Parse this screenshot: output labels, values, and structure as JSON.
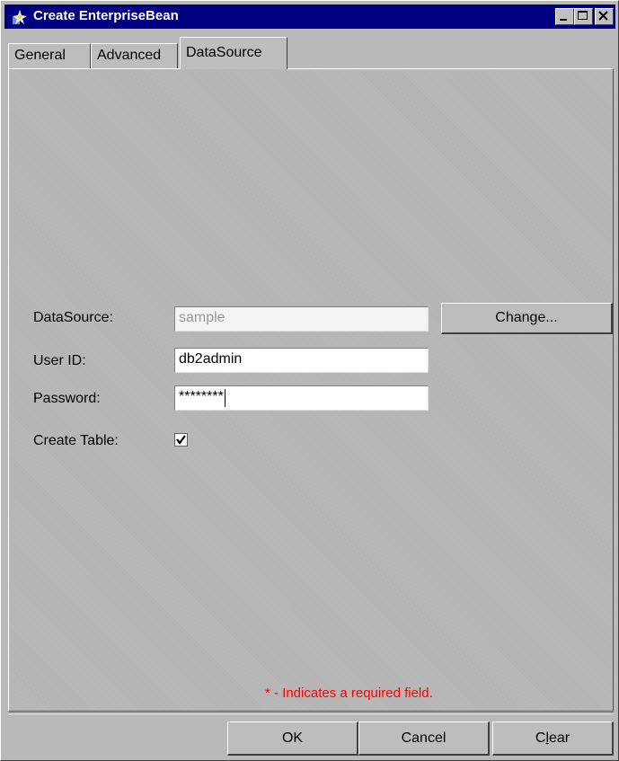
{
  "window": {
    "title": "Create EnterpriseBean",
    "colors": {
      "titlebar": "#000080",
      "face": "#c0c0c0",
      "required_text": "#ff0000"
    },
    "controls": [
      "minimize-icon",
      "maximize-icon",
      "close-icon"
    ]
  },
  "tabs": [
    {
      "label": "General"
    },
    {
      "label": "Advanced"
    },
    {
      "label": "DataSource",
      "selected": true
    }
  ],
  "form": {
    "datasource_label": "DataSource:",
    "datasource_value": "sample",
    "change_button": "Change...",
    "userid_label": "User ID:",
    "userid_value": "db2admin",
    "password_label": "Password:",
    "password_value": "********",
    "create_table_label": "Create Table:",
    "create_table_checked": true
  },
  "required_note": "* - Indicates a required field.",
  "buttons": {
    "ok": "OK",
    "cancel": "Cancel",
    "clear_prefix": "C",
    "clear_mnemonic": "l",
    "clear_suffix": "ear"
  }
}
